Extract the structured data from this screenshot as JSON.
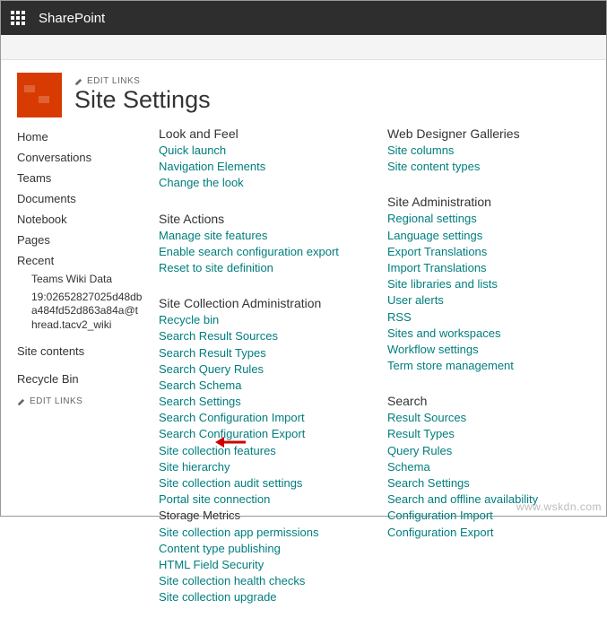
{
  "topbar": {
    "brand": "SharePoint"
  },
  "header": {
    "editLinks": "EDIT LINKS",
    "title": "Site Settings"
  },
  "leftnav": {
    "items": [
      "Home",
      "Conversations",
      "Teams",
      "Documents",
      "Notebook",
      "Pages"
    ],
    "recent": {
      "label": "Recent",
      "items": [
        "Teams Wiki Data",
        "19:02652827025d48dba484fd52d863a84a@thread.tacv2_wiki"
      ]
    },
    "footer": [
      "Site contents",
      "Recycle Bin"
    ],
    "editLinks": "EDIT LINKS"
  },
  "columns": [
    [
      {
        "title": "Look and Feel",
        "links": [
          "Quick launch",
          "Navigation Elements",
          "Change the look"
        ]
      },
      {
        "title": "Site Actions",
        "links": [
          "Manage site features",
          "Enable search configuration export",
          "Reset to site definition"
        ]
      },
      {
        "title": "Site Collection Administration",
        "links": [
          "Recycle bin",
          "Search Result Sources",
          "Search Result Types",
          "Search Query Rules",
          "Search Schema",
          "Search Settings",
          "Search Configuration Import",
          "Search Configuration Export",
          "Site collection features",
          "Site hierarchy",
          "Site collection audit settings",
          "Portal site connection",
          "Storage Metrics",
          "Site collection app permissions",
          "Content type publishing",
          "HTML Field Security",
          "Site collection health checks",
          "Site collection upgrade"
        ]
      }
    ],
    [
      {
        "title": "Web Designer Galleries",
        "links": [
          "Site columns",
          "Site content types"
        ]
      },
      {
        "title": "Site Administration",
        "links": [
          "Regional settings",
          "Language settings",
          "Export Translations",
          "Import Translations",
          "Site libraries and lists",
          "User alerts",
          "RSS",
          "Sites and workspaces",
          "Workflow settings",
          "Term store management"
        ]
      },
      {
        "title": "Search",
        "links": [
          "Result Sources",
          "Result Types",
          "Query Rules",
          "Schema",
          "Search Settings",
          "Search and offline availability",
          "Configuration Import",
          "Configuration Export"
        ]
      }
    ]
  ],
  "watermark": "www.wskdn.com"
}
